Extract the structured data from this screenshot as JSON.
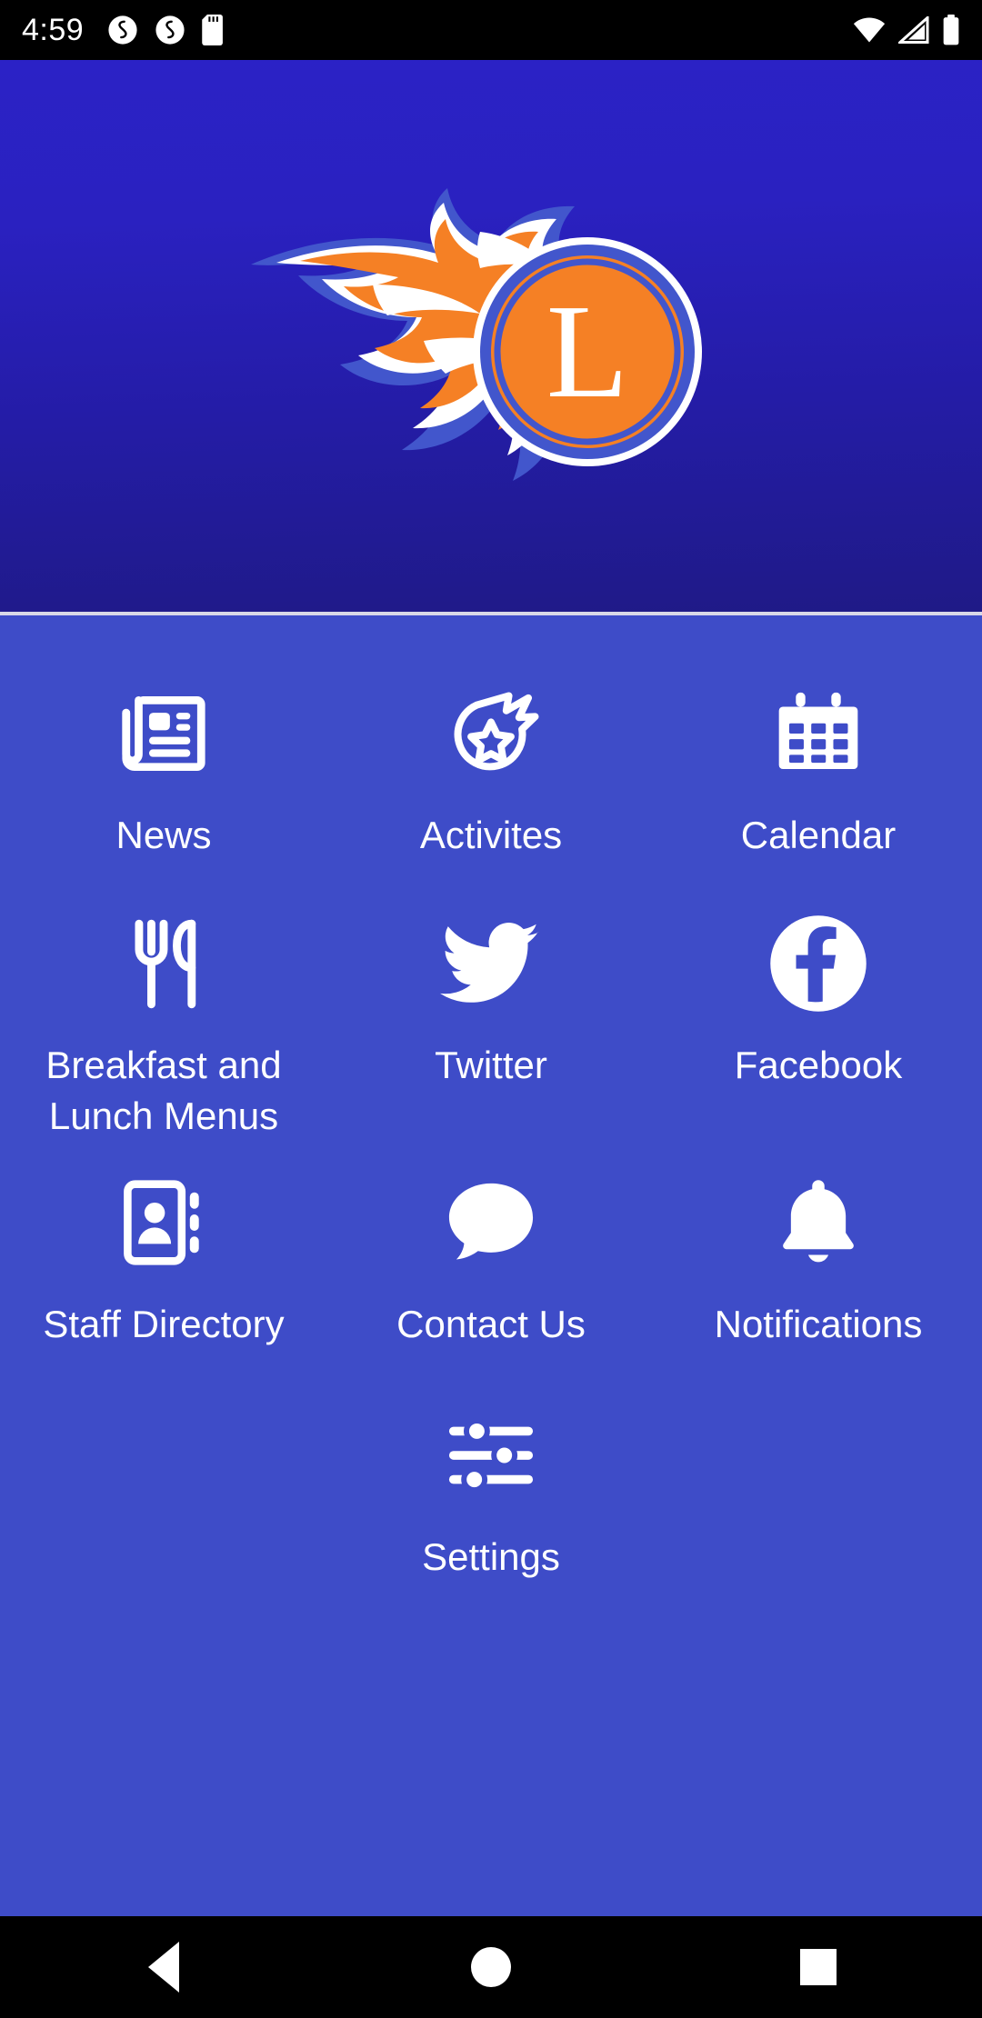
{
  "status_bar": {
    "time": "4:59",
    "left_icons": [
      "sync-disc-icon",
      "sync-disc-icon",
      "sd-card-icon"
    ],
    "right_icons": [
      "wifi-icon",
      "cellular-signal-icon",
      "battery-full-icon"
    ]
  },
  "header": {
    "logo_name": "flaming-comet-l-logo",
    "logo_letter": "L",
    "background_color": "#2A21C0",
    "flame_orange": "#F58025",
    "flame_blue": "#3F51C8",
    "flame_white": "#FFFFFF"
  },
  "theme": {
    "grid_background": "#3E4CC8",
    "icon_color": "#FFFFFF",
    "status_bar_background": "#000000",
    "nav_bar_background": "#000000"
  },
  "grid": {
    "rows": [
      [
        {
          "label": "News",
          "icon": "newspaper-icon"
        },
        {
          "label": "Activites",
          "icon": "comet-star-icon"
        },
        {
          "label": "Calendar",
          "icon": "calendar-icon"
        }
      ],
      [
        {
          "label": "Breakfast and Lunch Menus",
          "icon": "fork-knife-icon"
        },
        {
          "label": "Twitter",
          "icon": "twitter-bird-icon"
        },
        {
          "label": "Facebook",
          "icon": "facebook-icon"
        }
      ],
      [
        {
          "label": "Staff Directory",
          "icon": "address-book-icon"
        },
        {
          "label": "Contact Us",
          "icon": "speech-bubble-icon"
        },
        {
          "label": "Notifications",
          "icon": "bell-icon"
        }
      ],
      [
        {
          "label": "",
          "icon": ""
        },
        {
          "label": "Settings",
          "icon": "sliders-icon"
        },
        {
          "label": "",
          "icon": ""
        }
      ]
    ]
  },
  "nav_bar": {
    "back_label": "Back",
    "home_label": "Home",
    "recents_label": "Recents"
  }
}
